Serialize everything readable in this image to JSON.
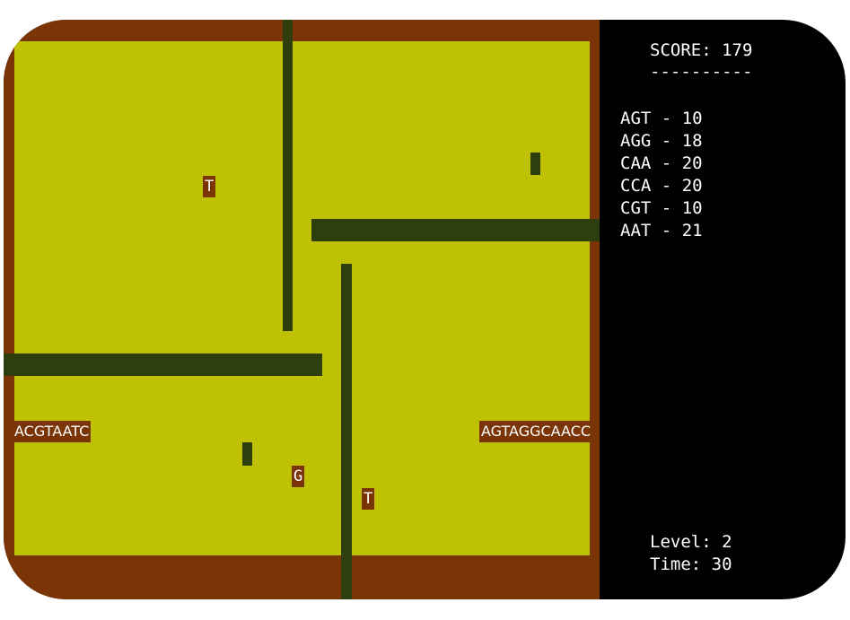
{
  "hud": {
    "score_label": "SCORE:",
    "score_value": "179",
    "rule": "----------",
    "codons": [
      {
        "codon": "AGT",
        "sep": "-",
        "points": "10"
      },
      {
        "codon": "AGG",
        "sep": "-",
        "points": "18"
      },
      {
        "codon": "CAA",
        "sep": "-",
        "points": "20"
      },
      {
        "codon": "CCA",
        "sep": "-",
        "points": "20"
      },
      {
        "codon": "CGT",
        "sep": "-",
        "points": "10"
      },
      {
        "codon": "AAT",
        "sep": "-",
        "points": "21"
      }
    ],
    "level_label": "Level:",
    "level_value": "2",
    "time_label": "Time:",
    "time_value": "30"
  },
  "board": {
    "snake_left": "ACGTAATC",
    "snake_right": "AGTAGGCAACC",
    "pickups": [
      "T",
      "G",
      "T"
    ]
  },
  "colors": {
    "background": "#000000",
    "field": "#bfc204",
    "border": "#7a3405",
    "wall": "#2e3f0d",
    "text": "#ffffff"
  }
}
